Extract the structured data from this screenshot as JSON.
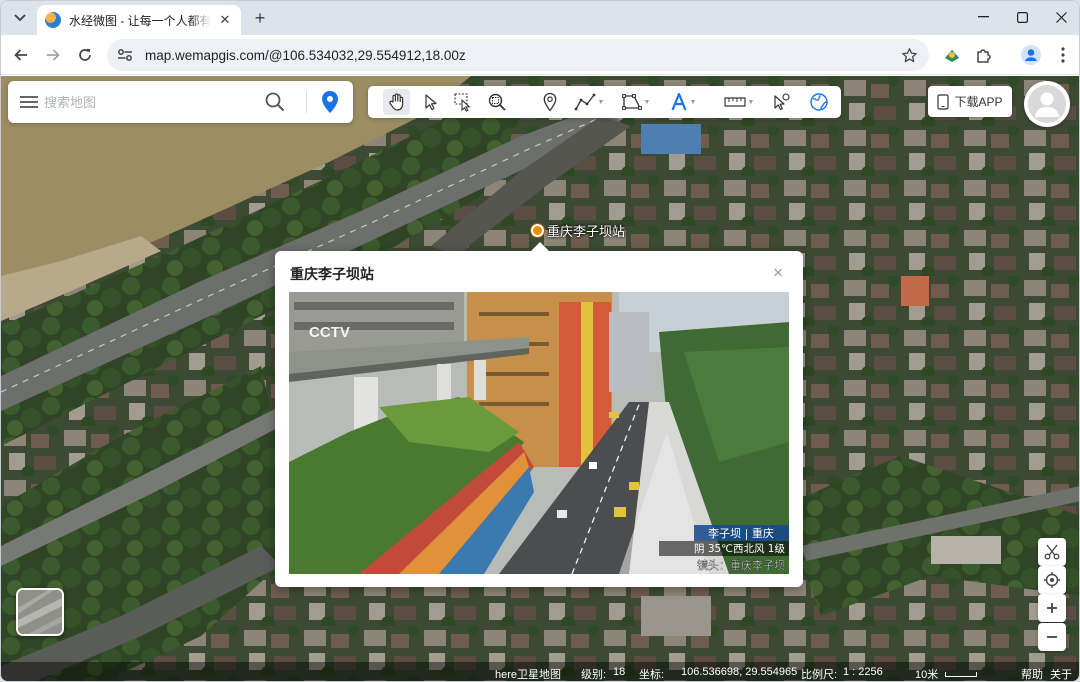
{
  "browser": {
    "tab_title": "水经微图 - 让每一个人都有自己的地图",
    "url": "map.wemapgis.com/@106.534032,29.554912,18.00z"
  },
  "search": {
    "placeholder": "搜索地图"
  },
  "toolbar": {
    "tools": [
      "pan-hand",
      "select-pointer",
      "box-select",
      "zoom-box",
      "place-marker",
      "draw-line",
      "draw-polygon",
      "add-text",
      "measure-ruler",
      "edit-pointer",
      "globe"
    ]
  },
  "download": {
    "label": "下载APP"
  },
  "marker": {
    "label": "重庆李子坝站"
  },
  "popup": {
    "title": "重庆李子坝站",
    "close": "×",
    "photo_overlay": {
      "logo": "CCTV",
      "location_tag": "李子坝 | 重庆",
      "weather": "阴 35℃西北风 1级",
      "caption": "镜头：重庆李子坝"
    }
  },
  "status": {
    "source": "here卫星地图",
    "level_label": "级别:",
    "level": "18",
    "coord_label": "坐标:",
    "coord": "106.536698, 29.554965",
    "scale_label": "比例尺:",
    "scale": "1 : 2256",
    "scale_bar_label": "10米",
    "help": "帮助",
    "about": "关于"
  },
  "colors": {
    "accent": "#1a73e8",
    "marker": "#f28a00"
  }
}
